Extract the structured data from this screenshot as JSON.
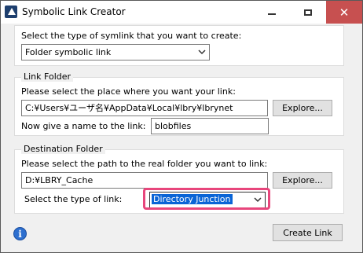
{
  "window": {
    "title": "Symbolic Link Creator",
    "minimize_glyph": "–",
    "maximize_glyph": "□",
    "close_glyph": "✕"
  },
  "symlink_type": {
    "prompt": "Select the type of symlink that you want to create:",
    "selected": "Folder symbolic link"
  },
  "link_folder": {
    "legend": "Link Folder",
    "prompt": "Please select the place where you want your link:",
    "path_value": "C:¥Users¥ユーザ名¥AppData¥Local¥lbry¥lbrynet",
    "explore_label": "Explore...",
    "name_prompt": "Now give a name to the link:",
    "name_value": "blobfiles"
  },
  "destination_folder": {
    "legend": "Destination Folder",
    "prompt": "Please select the path to the real folder you want to link:",
    "path_value": "D:¥LBRY_Cache",
    "explore_label": "Explore...",
    "link_type_prompt": "Select the type of link:",
    "link_type_selected": "Directory Junction"
  },
  "footer": {
    "create_label": "Create Link",
    "info_glyph": "i"
  },
  "colors": {
    "highlight": "#e8467c",
    "selection": "#0a64d6",
    "close_hover": "#c75050"
  },
  "icons": [
    "app-icon",
    "chevron-down-icon",
    "info-icon"
  ]
}
